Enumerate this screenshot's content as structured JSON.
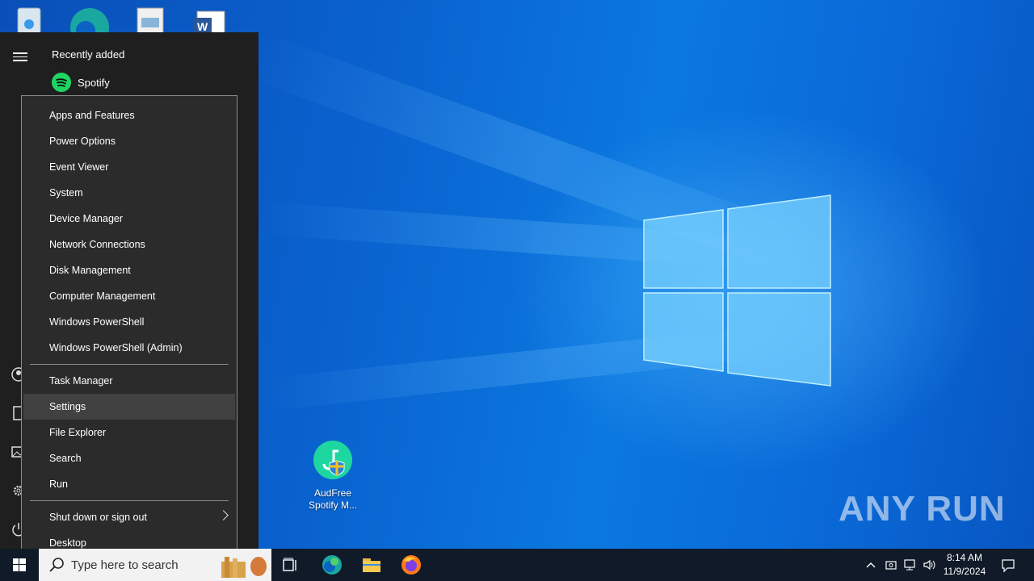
{
  "desktop": {
    "top_icons": [
      "recycle-bin-icon",
      "edge-desktop-icon",
      "document-icon",
      "word-icon"
    ],
    "shortcut": {
      "label_line1": "AudFree",
      "label_line2": "Spotify M..."
    },
    "watermark": "ANY RUN"
  },
  "start_menu": {
    "section_title": "Recently added",
    "recent_app": "Spotify"
  },
  "winx_menu": {
    "items": [
      {
        "label": "Apps and Features"
      },
      {
        "label": "Power Options"
      },
      {
        "label": "Event Viewer"
      },
      {
        "label": "System"
      },
      {
        "label": "Device Manager"
      },
      {
        "label": "Network Connections"
      },
      {
        "label": "Disk Management"
      },
      {
        "label": "Computer Management"
      },
      {
        "label": "Windows PowerShell"
      },
      {
        "label": "Windows PowerShell (Admin)"
      },
      {
        "label": "Task Manager"
      },
      {
        "label": "Settings",
        "highlighted": true
      },
      {
        "label": "File Explorer"
      },
      {
        "label": "Search"
      },
      {
        "label": "Run"
      },
      {
        "label": "Shut down or sign out",
        "submenu": true
      },
      {
        "label": "Desktop"
      }
    ]
  },
  "taskbar": {
    "search_placeholder": "Type here to search",
    "apps": [
      "task-view-icon",
      "edge-icon",
      "file-explorer-icon",
      "firefox-icon"
    ],
    "time": "8:14 AM",
    "date": "11/9/2024"
  },
  "colors": {
    "menu_bg": "#2b2b2b",
    "menu_highlight": "#414141",
    "start_bg": "#1f1f1f",
    "taskbar_bg": "#101a28",
    "spotify_green": "#1ed760"
  }
}
